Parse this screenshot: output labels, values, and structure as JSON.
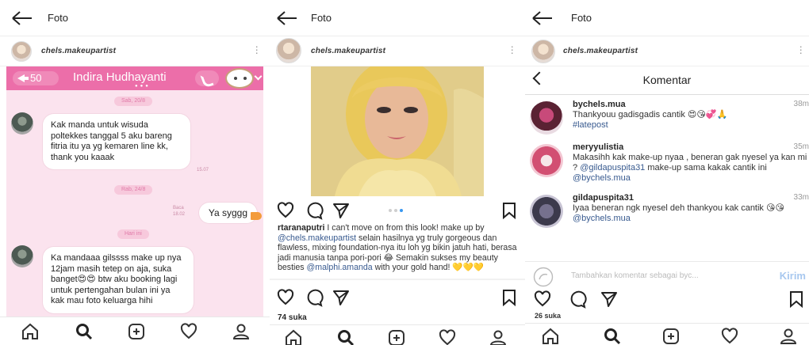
{
  "panel1": {
    "header_title": "Foto",
    "username": "chels.makeupartist",
    "chat": {
      "back_count": "50",
      "contact_name": "Indira Hudhayanti",
      "date1": "Sab, 20/8",
      "msg1": "Kak manda untuk wisuda poltekkes tanggal 5 aku bareng fitria itu ya yg kemaren line kk, thank you kaaak",
      "msg1_time": "15.07",
      "date2": "Rab, 24/8",
      "read_label": "Baca",
      "reply_time": "18.02",
      "reply": "Ya syggg",
      "date3": "Hari ini",
      "msg2": "Ka mandaaa gilssss make up nya 12jam masih tetep on aja, suka banget😍😍 btw aku booking lagi untuk pertengahan bulan ini ya kak mau foto keluarga hihi"
    }
  },
  "panel2": {
    "header_title": "Foto",
    "username": "chels.makeupartist",
    "caption_user": "rtaranaputri",
    "caption_1": " I can't move on from this look! make up by ",
    "caption_mention1": "@chels.makeupartist",
    "caption_2": " selain hasilnya yg truly gorgeous dan flawless, mixing foundation-nya itu loh yg bikin jatuh hati, berasa jadi manusia tanpa pori-pori 😂 Semakin sukses my beauty besties ",
    "caption_mention2": "@malphi.amanda",
    "caption_3": " with your gold hand! 💛💛💛",
    "likes": "74 suka"
  },
  "panel3": {
    "header_title": "Foto",
    "username": "chels.makeupartist",
    "comments_title": "Komentar",
    "comments": [
      {
        "user": "bychels.mua",
        "time": "38m",
        "text": "Thankyouu gadisgadis cantik 😍😘💞🙏",
        "tag": "#latepost"
      },
      {
        "user": "meryyulistia",
        "time": "35m",
        "text": "Makasihh kak make-up nyaa , beneran gak nyesel ya kan mi ? ",
        "tag": "@gildapuspita31",
        "text2": " make-up sama kakak cantik ini ",
        "tag2": "@bychels.mua"
      },
      {
        "user": "gildapuspita31",
        "time": "33m",
        "text": "Iyaa beneran ngk nyesel deh thankyou kak cantik 😘😘 ",
        "tag": "@bychels.mua"
      }
    ],
    "add_comment_placeholder": "Tambahkan komentar sebagai byc...",
    "post_label": "Kirim",
    "likes": "26 suka"
  },
  "colors": {
    "line_pink": "#ec6ea9",
    "chat_bg": "#fbe3ee",
    "link_blue": "#385a8f",
    "post_blue": "#a8c8ef"
  }
}
